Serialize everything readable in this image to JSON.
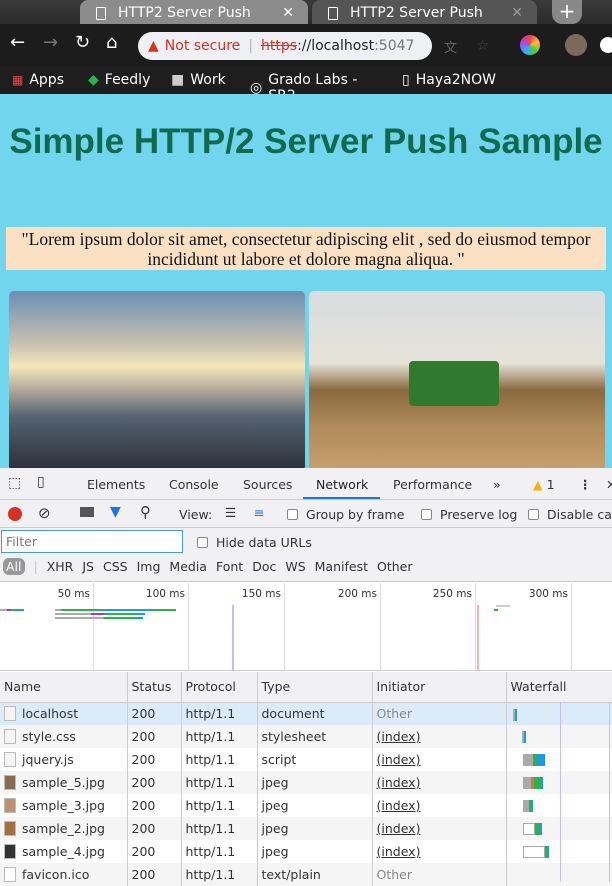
{
  "browser": {
    "tabs": [
      {
        "title": "HTTP2 Server Push",
        "active": true
      },
      {
        "title": "HTTP2 Server Push",
        "active": false
      }
    ],
    "security": "Not secure",
    "url_scheme": "https",
    "url_host": "://localhost",
    "url_port": ":5047",
    "bookmarks": [
      "Apps",
      "Feedly",
      "Work",
      "Grado Labs - SR2",
      "Haya2NOW"
    ]
  },
  "page": {
    "title": "Simple HTTP/2 Server Push Sample",
    "quote": "\"Lorem ipsum dolor sit amet, consectetur adipiscing elit , sed do eiusmod tempor incididunt ut labore et dolore magna aliqua. \""
  },
  "devtools": {
    "tabs": [
      "Elements",
      "Console",
      "Sources",
      "Network",
      "Performance"
    ],
    "active_tab": "Network",
    "warning_count": "1",
    "view_label": "View:",
    "group_by_frame": "Group by frame",
    "preserve_log": "Preserve log",
    "disable_cache": "Disable cache",
    "filter_placeholder": "Filter",
    "hide_data_urls": "Hide data URLs",
    "type_filters": [
      "All",
      "XHR",
      "JS",
      "CSS",
      "Img",
      "Media",
      "Font",
      "Doc",
      "WS",
      "Manifest",
      "Other"
    ],
    "timeline_ticks": [
      "50 ms",
      "100 ms",
      "150 ms",
      "200 ms",
      "250 ms",
      "300 ms"
    ],
    "columns": [
      "Name",
      "Status",
      "Protocol",
      "Type",
      "Initiator",
      "Waterfall"
    ],
    "rows": [
      {
        "name": "localhost",
        "status": "200",
        "protocol": "http/1.1",
        "type": "document",
        "initiator": "Other"
      },
      {
        "name": "style.css",
        "status": "200",
        "protocol": "http/1.1",
        "type": "stylesheet",
        "initiator": "(index)"
      },
      {
        "name": "jquery.js",
        "status": "200",
        "protocol": "http/1.1",
        "type": "script",
        "initiator": "(index)"
      },
      {
        "name": "sample_5.jpg",
        "status": "200",
        "protocol": "http/1.1",
        "type": "jpeg",
        "initiator": "(index)"
      },
      {
        "name": "sample_3.jpg",
        "status": "200",
        "protocol": "http/1.1",
        "type": "jpeg",
        "initiator": "(index)"
      },
      {
        "name": "sample_2.jpg",
        "status": "200",
        "protocol": "http/1.1",
        "type": "jpeg",
        "initiator": "(index)"
      },
      {
        "name": "sample_4.jpg",
        "status": "200",
        "protocol": "http/1.1",
        "type": "jpeg",
        "initiator": "(index)"
      },
      {
        "name": "favicon.ico",
        "status": "200",
        "protocol": "http/1.1",
        "type": "text/plain",
        "initiator": "Other"
      }
    ]
  },
  "colors": {
    "page_bg": "#72d5ee",
    "title": "#0f6b4f",
    "quote_bg": "#fbe0c3",
    "accent": "#1a73e8",
    "record": "#d93025"
  }
}
